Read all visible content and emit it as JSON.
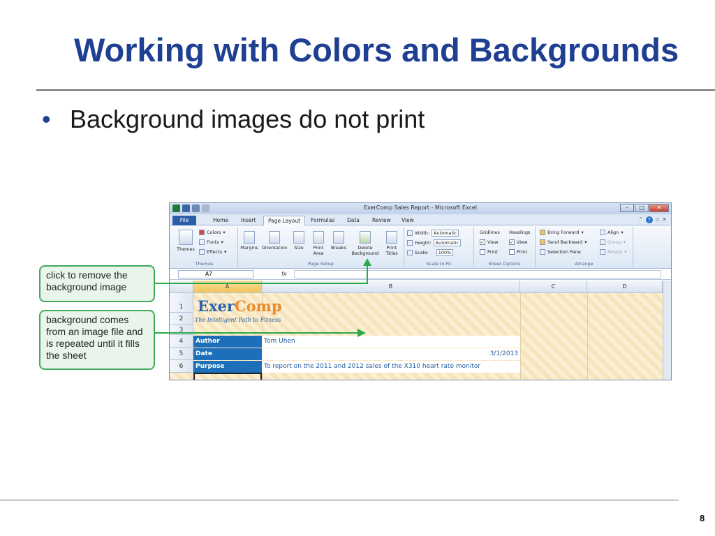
{
  "slide": {
    "title": "Working with Colors and Backgrounds",
    "bullet": "Background images do not print",
    "page_number": "8"
  },
  "excel": {
    "window_title": "ExerComp Sales Report - Microsoft Excel",
    "tabs": [
      "File",
      "Home",
      "Insert",
      "Page Layout",
      "Formulas",
      "Data",
      "Review",
      "View"
    ],
    "active_tab": "Page Layout",
    "ribbon": {
      "themes_group": {
        "label": "Themes",
        "themes_btn": "Themes",
        "colors": "Colors",
        "fonts": "Fonts",
        "effects": "Effects"
      },
      "page_setup_group": {
        "label": "Page Setup",
        "margins": "Margins",
        "orientation": "Orientation",
        "size": "Size",
        "print_area_1": "Print",
        "print_area_2": "Area",
        "breaks": "Breaks",
        "delete_bg_1": "Delete",
        "delete_bg_2": "Background",
        "print_titles_1": "Print",
        "print_titles_2": "Titles"
      },
      "scale_group": {
        "label": "Scale to Fit",
        "width_label": "Width:",
        "width_value": "Automatic",
        "height_label": "Height:",
        "height_value": "Automatic",
        "scale_label": "Scale:",
        "scale_value": "100%"
      },
      "sheet_options_group": {
        "label": "Sheet Options",
        "gridlines": "Gridlines",
        "headings": "Headings",
        "view": "View",
        "print": "Print"
      },
      "arrange_group": {
        "label": "Arrange",
        "bring_forward": "Bring Forward",
        "send_backward": "Send Backward",
        "selection_pane": "Selection Pane",
        "align": "Align",
        "group": "Group",
        "rotate": "Rotate"
      }
    },
    "name_box": "A7",
    "fx": "fx",
    "columns": [
      "A",
      "B",
      "C",
      "D"
    ],
    "rows": [
      "1",
      "2",
      "3",
      "4",
      "5",
      "6"
    ],
    "logo_part1": "Exer",
    "logo_part2": "Comp",
    "tagline": "The Intelligent Path to Fitness",
    "cells": {
      "a4": "Author",
      "b4": "Tom Uhen",
      "a5": "Date",
      "b5": "3/1/2013",
      "a6": "Purpose",
      "b6": "To report on the 2011 and 2012 sales of the X310 heart rate monitor"
    }
  },
  "callouts": {
    "remove": "click to remove the background image",
    "bg_source": "background comes from an image file and is repeated until it fills the sheet"
  }
}
